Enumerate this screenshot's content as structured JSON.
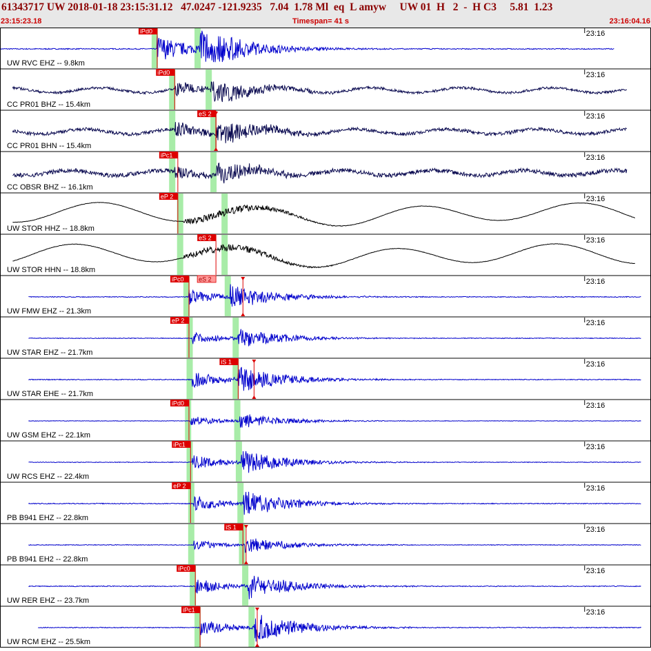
{
  "header": {
    "title": "61343717 UW 2018-01-18 23:15:31.12   47.0247 -121.9235   7.04  1.78 Ml  eq  L amyw     UW 01  H   2  -  H C3     5.81  1.23",
    "start_time": "23:15:23.18",
    "timespan": "Timespan=  41 s",
    "end_time": "23:16:04.16"
  },
  "chart_data": {
    "type": "line",
    "title": "61343717 UW 2018-01-18 23:15:31.12",
    "x_unit": "s",
    "xlim": [
      0,
      41
    ],
    "time_tick_label": "23:16",
    "time_tick_offset_s": 36.82,
    "colors": {
      "trace_blue": "#0000cc",
      "trace_navy": "#0a0a50",
      "trace_black": "#000000",
      "window_green": "#a8eca8",
      "pick_red": "#dd0000",
      "pick_pink": "#ff9999"
    },
    "series": [
      {
        "name": "UW RVC EHZ -- 9.8km",
        "color": "#0000cc",
        "p": 9.9,
        "s": 12.6,
        "pick_label": "iPd0",
        "pick_time": 9.9,
        "pick_style": "red",
        "start": 0,
        "end": 38.7,
        "noise": 0.012,
        "amp": 1.0,
        "kind": "spike"
      },
      {
        "name": "CC PR01 BHZ -- 15.4km",
        "color": "#0a0a50",
        "p": 11.0,
        "s": 13.3,
        "pick_label": "iPd0",
        "pick_time": 11.0,
        "pick_style": "red",
        "start": 0.8,
        "end": 39.5,
        "noise": 0.03,
        "amp": 0.55,
        "kind": "broadband"
      },
      {
        "name": "CC PR01 BHN -- 15.4km",
        "color": "#0a0a50",
        "p": 11.0,
        "s": 13.6,
        "pick_label": "eS 2",
        "pick_time": 13.6,
        "pick_style": "red",
        "tpick": 13.6,
        "start": 0.8,
        "end": 39.5,
        "noise": 0.04,
        "amp": 0.6,
        "kind": "broadband"
      },
      {
        "name": "CC OBSR BHZ -- 16.1km",
        "color": "#0a0a50",
        "p": 11.0,
        "s": 13.6,
        "pick_label": "iPc1",
        "pick_time": 11.2,
        "pick_style": "red",
        "start": 0.8,
        "end": 39.5,
        "noise": 0.05,
        "amp": 0.5,
        "kind": "broadband"
      },
      {
        "name": "UW STOR HHZ -- 18.8km",
        "color": "#000000",
        "p": 11.5,
        "s": 14.3,
        "pick_label": "eP 2",
        "pick_time": 11.2,
        "pick_style": "red",
        "start": 0.8,
        "end": 40.0,
        "noise": 0.0,
        "amp": 0.35,
        "kind": "longperiod"
      },
      {
        "name": "UW STOR HHN -- 18.8km",
        "color": "#000000",
        "p": 11.5,
        "s": 14.3,
        "pick_label": "eS 2",
        "pick_time": 13.6,
        "pick_style": "red",
        "start": 0.8,
        "end": 40.0,
        "noise": 0.0,
        "amp": 0.35,
        "kind": "longperiod"
      },
      {
        "name": "UW FMW EHZ -- 21.3km",
        "color": "#0000cc",
        "p": 11.9,
        "s": 14.5,
        "pick_label": "iPc0",
        "pick_time": 11.9,
        "pick_style": "red",
        "pick2_label": "eS 2",
        "pick2_time": 13.6,
        "pick2_style": "pink",
        "tpick": 15.3,
        "start": 1.8,
        "end": 40.4,
        "noise": 0.01,
        "amp": 0.55,
        "kind": "spike"
      },
      {
        "name": "UW STAR EHZ -- 21.7km",
        "color": "#0000cc",
        "p": 12.1,
        "s": 15.0,
        "pick_label": "eP 2",
        "pick_time": 11.9,
        "pick_style": "red",
        "start": 1.8,
        "end": 40.4,
        "noise": 0.008,
        "amp": 0.45,
        "kind": "spike"
      },
      {
        "name": "UW STAR EHE -- 21.7km",
        "color": "#0000cc",
        "p": 12.1,
        "s": 15.0,
        "pick_label": "iS 1",
        "pick_time": 15.0,
        "pick_style": "red",
        "tpick": 16.0,
        "start": 1.8,
        "end": 40.4,
        "noise": 0.01,
        "amp": 0.6,
        "kind": "spike"
      },
      {
        "name": "UW GSM EHZ -- 22.1km",
        "color": "#0000cc",
        "p": 12.0,
        "s": 15.1,
        "pick_label": "iPd0",
        "pick_time": 11.9,
        "pick_style": "red",
        "start": 1.8,
        "end": 40.4,
        "noise": 0.006,
        "amp": 0.35,
        "kind": "spike"
      },
      {
        "name": "UW RCS EHZ -- 22.4km",
        "color": "#0000cc",
        "p": 12.1,
        "s": 15.2,
        "pick_label": "iPc1",
        "pick_time": 12.0,
        "pick_style": "red",
        "start": 1.8,
        "end": 40.4,
        "noise": 0.008,
        "amp": 0.55,
        "kind": "spike"
      },
      {
        "name": "PB B941 EHZ -- 22.8km",
        "color": "#0000cc",
        "p": 12.2,
        "s": 15.3,
        "pick_label": "eP 2",
        "pick_time": 12.0,
        "pick_style": "red",
        "start": 1.8,
        "end": 40.4,
        "noise": 0.01,
        "amp": 0.6,
        "kind": "spike"
      },
      {
        "name": "PB B941 EH2 -- 22.8km",
        "color": "#0000cc",
        "p": 12.2,
        "s": 15.4,
        "pick_label": "iS 1",
        "pick_time": 15.3,
        "pick_style": "red",
        "tpick": 15.5,
        "start": 1.8,
        "end": 40.4,
        "noise": 0.008,
        "amp": 0.35,
        "kind": "spike"
      },
      {
        "name": "UW RER EHZ -- 23.7km",
        "color": "#0000cc",
        "p": 12.3,
        "s": 15.6,
        "pick_label": "iPc0",
        "pick_time": 12.3,
        "pick_style": "red",
        "start": 1.8,
        "end": 40.4,
        "noise": 0.01,
        "amp": 0.6,
        "kind": "spike"
      },
      {
        "name": "UW RCM EHZ -- 25.5km",
        "color": "#0000cc",
        "p": 12.6,
        "s": 16.0,
        "pick_label": "iPc1",
        "pick_time": 12.6,
        "pick_style": "red",
        "tpick": 16.2,
        "start": 2.4,
        "end": 40.4,
        "noise": 0.01,
        "amp": 0.65,
        "kind": "spike"
      }
    ]
  }
}
